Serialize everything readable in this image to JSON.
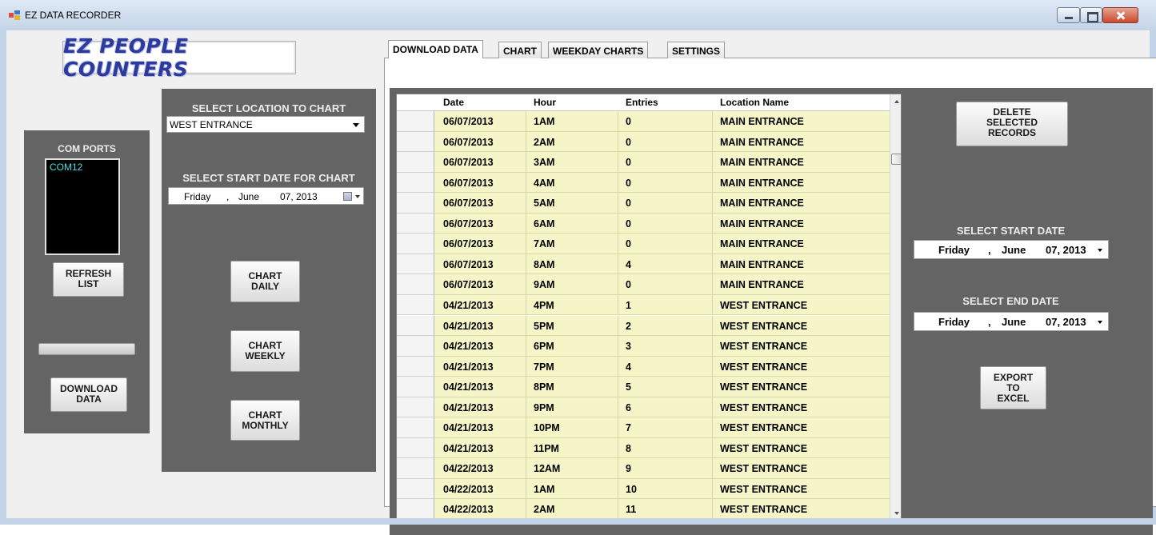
{
  "window": {
    "title": "EZ DATA RECORDER"
  },
  "logo": {
    "text": "EZ PEOPLE COUNTERS"
  },
  "com_panel": {
    "label": "COM PORTS",
    "ports": [
      "COM12"
    ],
    "refresh_label": "REFRESH\nLIST",
    "download_label": "DOWNLOAD\nDATA"
  },
  "location_panel": {
    "location_label": "SELECT LOCATION TO CHART",
    "location_value": "WEST ENTRANCE",
    "start_label": "SELECT START DATE FOR CHART",
    "date": {
      "weekday": "Friday",
      "sep": ",",
      "month": "June",
      "day_year": "07, 2013"
    },
    "chart_daily_label": "CHART\nDAILY",
    "chart_weekly_label": "CHART\nWEEKLY",
    "chart_monthly_label": "CHART\nMONTHLY"
  },
  "tabs": [
    "DOWNLOAD DATA",
    "CHART",
    "WEEKDAY CHARTS",
    "SETTINGS"
  ],
  "grid": {
    "columns": [
      "Date",
      "Hour",
      "Entries",
      "Location Name"
    ],
    "rows": [
      [
        "06/07/2013",
        "1AM",
        "0",
        "MAIN ENTRANCE"
      ],
      [
        "06/07/2013",
        "2AM",
        "0",
        "MAIN ENTRANCE"
      ],
      [
        "06/07/2013",
        "3AM",
        "0",
        "MAIN ENTRANCE"
      ],
      [
        "06/07/2013",
        "4AM",
        "0",
        "MAIN ENTRANCE"
      ],
      [
        "06/07/2013",
        "5AM",
        "0",
        "MAIN ENTRANCE"
      ],
      [
        "06/07/2013",
        "6AM",
        "0",
        "MAIN ENTRANCE"
      ],
      [
        "06/07/2013",
        "7AM",
        "0",
        "MAIN ENTRANCE"
      ],
      [
        "06/07/2013",
        "8AM",
        "4",
        "MAIN ENTRANCE"
      ],
      [
        "06/07/2013",
        "9AM",
        "0",
        "MAIN ENTRANCE"
      ],
      [
        "04/21/2013",
        "4PM",
        "1",
        "WEST ENTRANCE"
      ],
      [
        "04/21/2013",
        "5PM",
        "2",
        "WEST ENTRANCE"
      ],
      [
        "04/21/2013",
        "6PM",
        "3",
        "WEST ENTRANCE"
      ],
      [
        "04/21/2013",
        "7PM",
        "4",
        "WEST ENTRANCE"
      ],
      [
        "04/21/2013",
        "8PM",
        "5",
        "WEST ENTRANCE"
      ],
      [
        "04/21/2013",
        "9PM",
        "6",
        "WEST ENTRANCE"
      ],
      [
        "04/21/2013",
        "10PM",
        "7",
        "WEST ENTRANCE"
      ],
      [
        "04/21/2013",
        "11PM",
        "8",
        "WEST ENTRANCE"
      ],
      [
        "04/22/2013",
        "12AM",
        "9",
        "WEST ENTRANCE"
      ],
      [
        "04/22/2013",
        "1AM",
        "10",
        "WEST ENTRANCE"
      ],
      [
        "04/22/2013",
        "2AM",
        "11",
        "WEST ENTRANCE"
      ]
    ]
  },
  "right_panel": {
    "delete_label": "DELETE\nSELECTED\nRECORDS",
    "start_label": "SELECT START DATE",
    "start_date": {
      "weekday": "Friday",
      "sep": ",",
      "month": "June",
      "day_year": "07, 2013"
    },
    "end_label": "SELECT END DATE",
    "end_date": {
      "weekday": "Friday",
      "sep": ",",
      "month": "June",
      "day_year": "07, 2013"
    },
    "export_label": "EXPORT\nTO\nEXCEL"
  },
  "colors": {
    "panel": "#646464",
    "grid_cell": "#f5f5c8",
    "com_text": "#3fe0e0",
    "logo": "#2e3a9a"
  }
}
